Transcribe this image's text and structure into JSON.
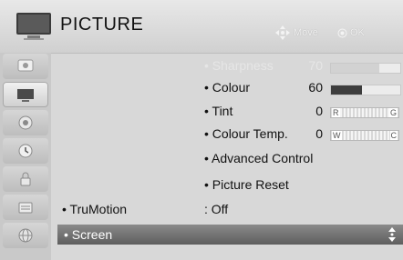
{
  "header": {
    "title": "PICTURE",
    "hint_move": "Move",
    "hint_ok": "OK"
  },
  "sidebar": {
    "items": [
      {
        "icon": "picture-sound-icon"
      },
      {
        "icon": "tv-picture-icon",
        "active": true
      },
      {
        "icon": "audio-icon"
      },
      {
        "icon": "clock-icon"
      },
      {
        "icon": "lock-icon"
      },
      {
        "icon": "option-icon"
      },
      {
        "icon": "network-icon"
      }
    ]
  },
  "menu": {
    "sharpness": {
      "label": "• Sharpness",
      "value": "70",
      "level": 0.7
    },
    "colour": {
      "label": "• Colour",
      "value": "60",
      "level": 0.45
    },
    "tint": {
      "label": "• Tint",
      "value": "0",
      "left_end": "R",
      "right_end": "G"
    },
    "colour_temp": {
      "label": "• Colour Temp.",
      "value": "0",
      "left_end": "W",
      "right_end": "C"
    },
    "advanced": {
      "label": "• Advanced Control"
    },
    "reset": {
      "label": "• Picture Reset"
    },
    "trumotion": {
      "label": "• TruMotion",
      "value": ": Off"
    },
    "screen": {
      "label": "• Screen"
    }
  }
}
